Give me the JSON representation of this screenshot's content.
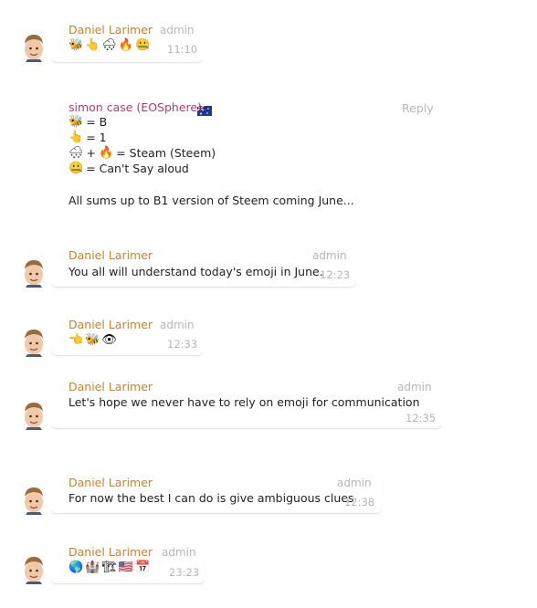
{
  "messages": [
    {
      "name": "Daniel Larimer",
      "role": "admin",
      "time": "11:10",
      "emojis": [
        "🐝",
        "👆",
        "🌨",
        "🔥",
        "🤐"
      ]
    },
    {
      "name": "simon case (EOSphere)",
      "reply": "Reply",
      "lines": [
        {
          "emojis": [
            "🐝"
          ],
          "text": "= B"
        },
        {
          "emojis": [
            "👆"
          ],
          "text": "= 1"
        },
        {
          "emojis": [
            "🌨"
          ],
          "mid": "+",
          "emojis2": [
            "🔥"
          ],
          "text": "= Steam (Steem)"
        },
        {
          "emojis": [
            "🤐"
          ],
          "text": "= Can't Say aloud"
        }
      ],
      "summary": "All sums up to B1 version of Steem coming June..."
    },
    {
      "name": "Daniel Larimer",
      "role": "admin",
      "time": "12:23",
      "text": "You all will understand today's emoji in June."
    },
    {
      "name": "Daniel Larimer",
      "role": "admin",
      "time": "12:33",
      "emojis": [
        "👈",
        "🐝",
        "👁"
      ]
    },
    {
      "name": "Daniel Larimer",
      "role": "admin",
      "time": "12:35",
      "text": "Let's hope we never have to rely on emoji for communication"
    },
    {
      "name": "Daniel Larimer",
      "role": "admin",
      "time": "12:38",
      "text": "For now the best I can do is give ambiguous clues"
    },
    {
      "name": "Daniel Larimer",
      "role": "admin",
      "time": "23:23",
      "emojis": [
        "🌎",
        "🏰",
        "🏗",
        "🇺🇸",
        "📅"
      ]
    }
  ]
}
